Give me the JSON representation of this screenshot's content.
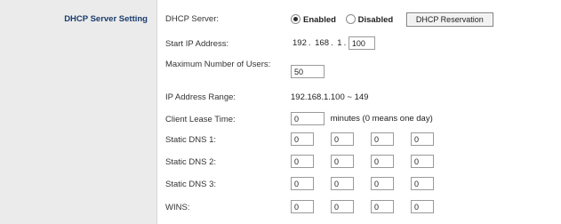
{
  "section": {
    "title": "DHCP Server Setting"
  },
  "dhcp_server": {
    "label": "DHCP Server:",
    "enabled_label": "Enabled",
    "disabled_label": "Disabled",
    "selected": "Enabled",
    "reservation_button": "DHCP Reservation"
  },
  "start_ip": {
    "label": "Start IP Address:",
    "octets_fixed": [
      "192",
      "168",
      "1"
    ],
    "last_octet": "100"
  },
  "max_users": {
    "label": "Maximum Number of Users:",
    "value": "50"
  },
  "ip_range": {
    "label": "IP Address Range:",
    "value": "192.168.1.100 ~ 149"
  },
  "lease_time": {
    "label": "Client Lease Time:",
    "value": "0",
    "unit_note": "minutes (0 means one day)"
  },
  "dns1": {
    "label": "Static DNS 1:",
    "octets": [
      "0",
      "0",
      "0",
      "0"
    ]
  },
  "dns2": {
    "label": "Static DNS 2:",
    "octets": [
      "0",
      "0",
      "0",
      "0"
    ]
  },
  "dns3": {
    "label": "Static DNS 3:",
    "octets": [
      "0",
      "0",
      "0",
      "0"
    ]
  },
  "wins": {
    "label": "WINS:",
    "octets": [
      "0",
      "0",
      "0",
      "0"
    ]
  }
}
